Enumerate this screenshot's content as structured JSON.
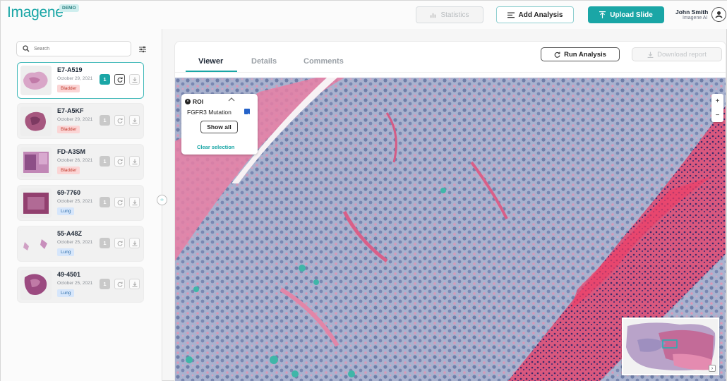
{
  "header": {
    "logo": "Imagene",
    "badge": "DEMO",
    "statistics_label": "Statistics",
    "add_analysis_label": "Add Analysis",
    "upload_label": "Upload Slide",
    "user_name": "John Smith",
    "user_org": "Imagene AI"
  },
  "sidebar": {
    "search_placeholder": "Search",
    "slides": [
      {
        "id": "E7-A519",
        "date": "October 29, 2021",
        "tag": "Bladder",
        "count": "1"
      },
      {
        "id": "E7-A5KF",
        "date": "October 29, 2021",
        "tag": "Bladder",
        "count": "1"
      },
      {
        "id": "FD-A3SM",
        "date": "October 26, 2021",
        "tag": "Bladder",
        "count": "1"
      },
      {
        "id": "69-7760",
        "date": "October 25, 2021",
        "tag": "Lung",
        "count": "1"
      },
      {
        "id": "55-A48Z",
        "date": "October 25, 2021",
        "tag": "Lung",
        "count": "1"
      },
      {
        "id": "49-4501",
        "date": "October 25, 2021",
        "tag": "Lung",
        "count": "1"
      }
    ]
  },
  "main": {
    "tabs": [
      "Viewer",
      "Details",
      "Comments"
    ],
    "active_tab": "Viewer",
    "run_analysis_label": "Run Analysis",
    "download_label": "Download report"
  },
  "roi": {
    "title": "ROI",
    "mutation_label": "FGFR3 Mutation",
    "mutation_checked": true,
    "show_all_label": "Show all",
    "clear_label": "Clear selection"
  },
  "zoom": {
    "plus": "+",
    "minus": "−"
  },
  "colors": {
    "accent": "#1aa6a6",
    "bladder": "#fbd5d5",
    "lung": "#d6e6fb"
  }
}
